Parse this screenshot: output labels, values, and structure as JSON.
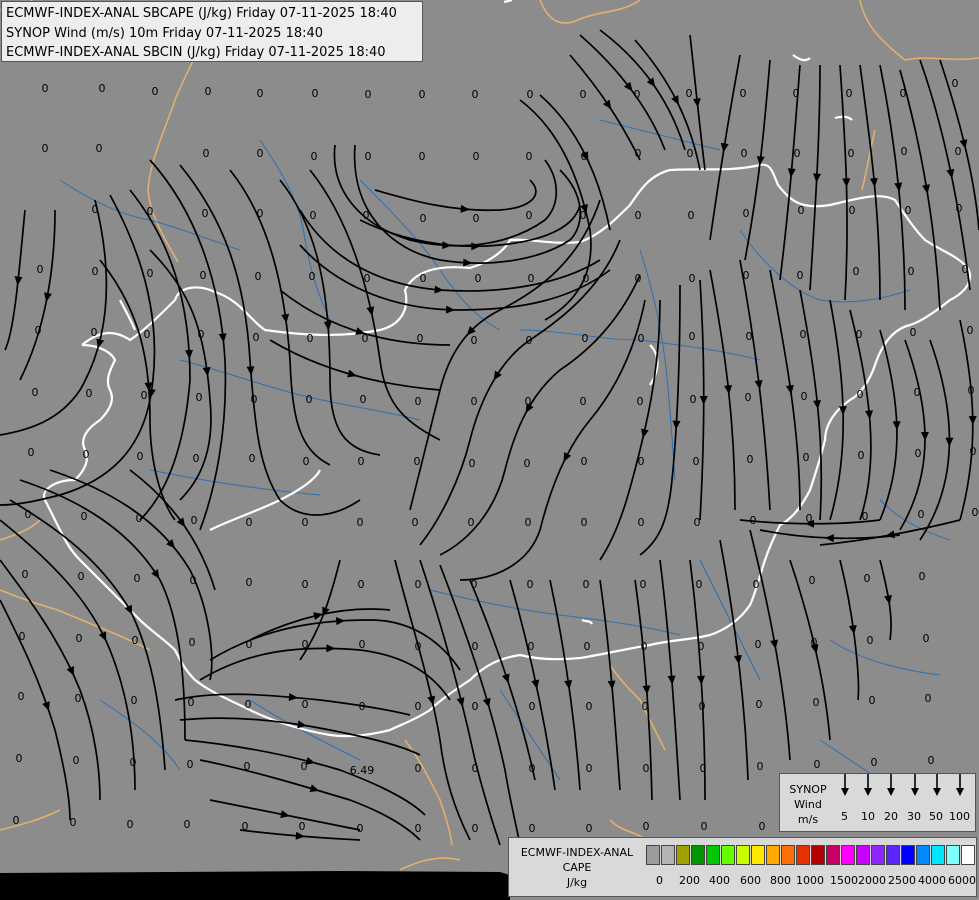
{
  "titles": {
    "line1": "ECMWF-INDEX-ANAL SBCAPE (J/kg) Friday 07-11-2025 18:40",
    "line2": "SYNOP Wind (m/s) 10m Friday 07-11-2025 18:40",
    "line3": "ECMWF-INDEX-ANAL SBCIN (J/kg) Friday 07-11-2025 18:40"
  },
  "synop_legend": {
    "label_lines": [
      "SYNOP",
      "Wind",
      "m/s"
    ],
    "speeds": [
      "5",
      "10",
      "20",
      "30",
      "50",
      "100"
    ]
  },
  "cape_legend": {
    "label_lines": [
      "ECMWF-INDEX-ANAL",
      "CAPE",
      "J/kg"
    ],
    "colors": [
      "#9b9b9b",
      "#b4b4b4",
      "#a0a000",
      "#009600",
      "#00c800",
      "#64ff00",
      "#c8ff00",
      "#ffe600",
      "#ffaa00",
      "#ff6e00",
      "#e63200",
      "#b40000",
      "#c80064",
      "#ff00ff",
      "#c800ff",
      "#8c28ff",
      "#5a28ff",
      "#0000ff",
      "#008cff",
      "#00e6ff",
      "#80ffff",
      "#ffffff"
    ],
    "ticks": [
      "0",
      "200",
      "400",
      "600",
      "800",
      "1000",
      "1500",
      "2000",
      "2500",
      "4000",
      "6000"
    ]
  },
  "station_values": [
    "0",
    "6.49"
  ],
  "colors": {
    "background": "#8c8c8c",
    "border_national": "#ffffff",
    "border_regional": "#e0b070",
    "rivers": "#2f6fb0",
    "streamline": "#000000"
  }
}
